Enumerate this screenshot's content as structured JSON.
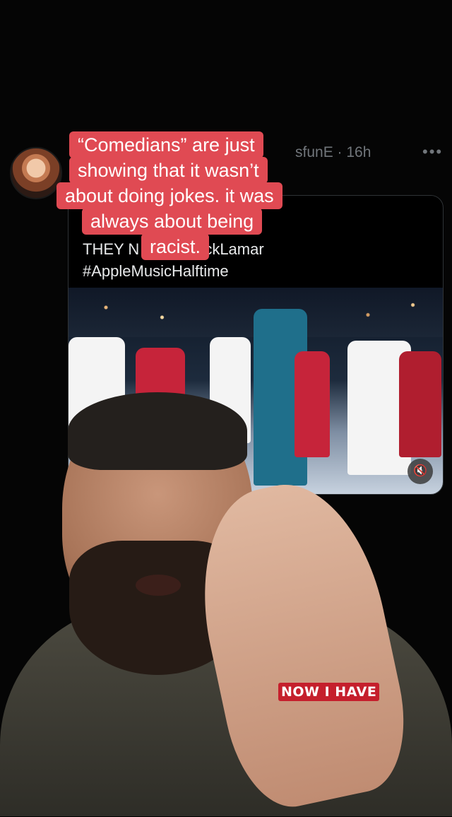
{
  "tweet": {
    "handle_fragment": "sfunE",
    "time": "· 16h",
    "more_icon": "ellipsis-icon"
  },
  "quote": {
    "text": "THEY N          @KendrickLamar\n#AppleMusicHalftime"
  },
  "caption": {
    "line1": "“Comedians” are just",
    "line2": "showing that it wasn’t",
    "line3": "about doing jokes. it was",
    "line4": "always about being",
    "line5": "racist."
  },
  "subtitle": {
    "text": "NOW I HAVE"
  },
  "media": {
    "mute_icon": "mute-icon",
    "mute_glyph": "🔇"
  },
  "colors": {
    "caption_bg": "#e04a53",
    "subtitle_bg": "#c51f2c",
    "meta_text": "#71767b"
  }
}
